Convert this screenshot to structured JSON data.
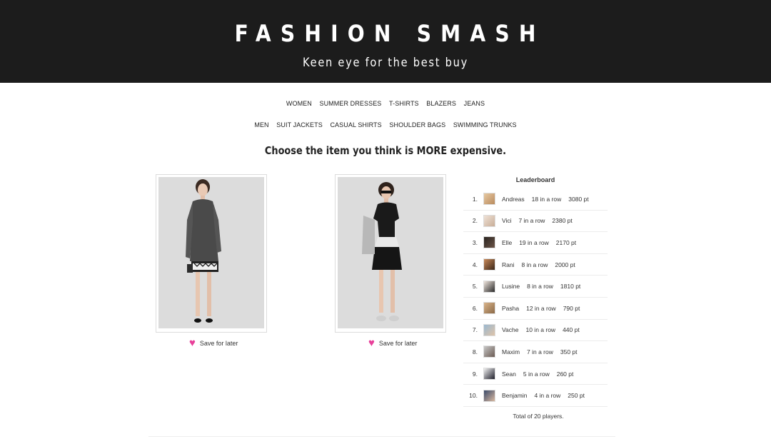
{
  "header": {
    "title": "FASHION SMASH",
    "tagline": "Keen eye for the best buy"
  },
  "nav": {
    "women": [
      "WOMEN",
      "SUMMER DRESSES",
      "T-SHIRTS",
      "BLAZERS",
      "JEANS"
    ],
    "men": [
      "MEN",
      "SUIT JACKETS",
      "CASUAL SHIRTS",
      "SHOULDER BAGS",
      "SWIMMING TRUNKS"
    ]
  },
  "question": "Choose the item you think is MORE expensive.",
  "products": [
    {
      "save_label": "Save for later",
      "icon": "heart-icon"
    },
    {
      "save_label": "Save for later",
      "icon": "heart-icon"
    }
  ],
  "leaderboard": {
    "title": "Leaderboard",
    "rows": [
      {
        "rank": "1.",
        "name": "Andreas",
        "streak": "18 in a row",
        "points": "3080 pt"
      },
      {
        "rank": "2.",
        "name": "Vici",
        "streak": "7 in a row",
        "points": "2380 pt"
      },
      {
        "rank": "3.",
        "name": "Elle",
        "streak": "19 in a row",
        "points": "2170 pt"
      },
      {
        "rank": "4.",
        "name": "Rani",
        "streak": "8 in a row",
        "points": "2000 pt"
      },
      {
        "rank": "5.",
        "name": "Lusine",
        "streak": "8 in a row",
        "points": "1810 pt"
      },
      {
        "rank": "6.",
        "name": "Pasha",
        "streak": "12 in a row",
        "points": "790 pt"
      },
      {
        "rank": "7.",
        "name": "Vache",
        "streak": "10 in a row",
        "points": "440 pt"
      },
      {
        "rank": "8.",
        "name": "Maxim",
        "streak": "7 in a row",
        "points": "350 pt"
      },
      {
        "rank": "9.",
        "name": "Sean",
        "streak": "5 in a row",
        "points": "260 pt"
      },
      {
        "rank": "10.",
        "name": "Benjamin",
        "streak": "4 in a row",
        "points": "250 pt"
      }
    ],
    "footer": "Total of 20 players."
  },
  "colors": {
    "header_bg": "#1c1c1c",
    "heart": "#e8409a"
  }
}
